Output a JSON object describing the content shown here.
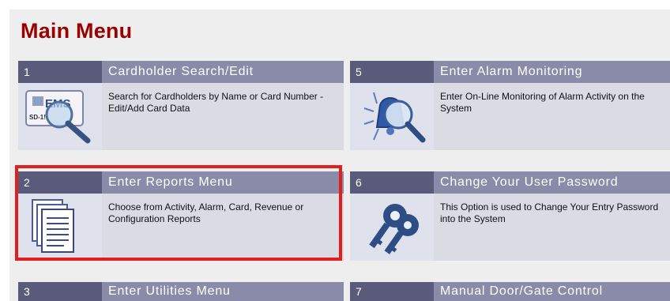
{
  "title": "Main Menu",
  "colors": {
    "title": "#990000",
    "number_header": "#5a5a7b",
    "title_header": "#8a8ba8",
    "selection_outline": "#e0201f"
  },
  "tiles": [
    {
      "number": "1",
      "title": "Cardholder Search/Edit",
      "description": "Search for Cardholders by Name or Card Number - Edit/Add Card Data",
      "icon": "cardholder-search-icon",
      "icon_text": "EMS",
      "icon_subtext": "SD-1!"
    },
    {
      "number": "2",
      "title": "Enter Reports Menu",
      "description": "Choose from Activity, Alarm, Card, Revenue or Configuration Reports",
      "icon": "reports-documents-icon",
      "selected": true
    },
    {
      "number": "3",
      "title": "Enter Utilities Menu"
    },
    {
      "number": "5",
      "title": "Enter Alarm Monitoring",
      "description": "Enter On-Line Monitoring of Alarm Activity on the System",
      "icon": "alarm-monitoring-icon"
    },
    {
      "number": "6",
      "title": "Change Your User Password",
      "description": "This Option is used to Change Your Entry Password into the System",
      "icon": "keys-icon"
    },
    {
      "number": "7",
      "title": "Manual Door/Gate Control"
    }
  ]
}
